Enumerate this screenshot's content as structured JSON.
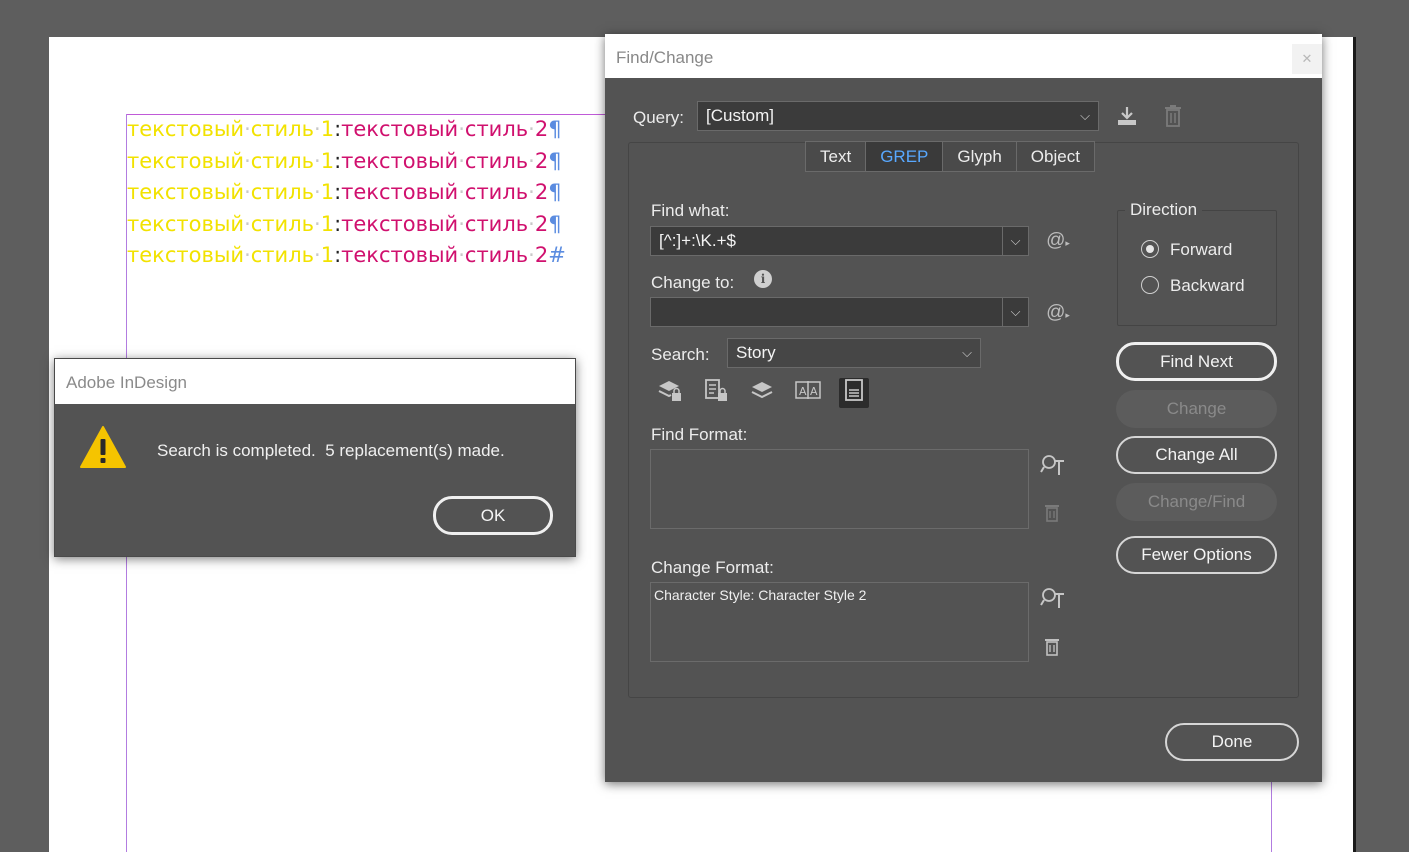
{
  "document": {
    "lines": [
      {
        "a": "текстовый",
        "b": "стиль",
        "c": "1",
        "sep": ":",
        "d": "текстовый",
        "e": "стиль",
        "f": "2",
        "end": "¶"
      },
      {
        "a": "текстовый",
        "b": "стиль",
        "c": "1",
        "sep": ":",
        "d": "текстовый",
        "e": "стиль",
        "f": "2",
        "end": "¶"
      },
      {
        "a": "текстовый",
        "b": "стиль",
        "c": "1",
        "sep": ":",
        "d": "текстовый",
        "e": "стиль",
        "f": "2",
        "end": "¶"
      },
      {
        "a": "текстовый",
        "b": "стиль",
        "c": "1",
        "sep": ":",
        "d": "текстовый",
        "e": "стиль",
        "f": "2",
        "end": "¶"
      },
      {
        "a": "текстовый",
        "b": "стиль",
        "c": "1",
        "sep": ":",
        "d": "текстовый",
        "e": "стиль",
        "f": "2",
        "end": "#"
      }
    ],
    "colors": {
      "style1": "#f2e200",
      "style2": "#d0106e",
      "hidden_chars": "#5b8ce0"
    }
  },
  "find_change": {
    "title": "Find/Change",
    "close": "✕",
    "query_label": "Query:",
    "query_value": "[Custom]",
    "tabs": [
      {
        "label": "Text"
      },
      {
        "label": "GREP",
        "active": true
      },
      {
        "label": "Glyph"
      },
      {
        "label": "Object"
      }
    ],
    "find_what_label": "Find what:",
    "find_what_value": "[^:]+:\\K.+$",
    "change_to_label": "Change to:",
    "change_to_value": "",
    "search_label": "Search:",
    "search_value": "Story",
    "find_format_label": "Find Format:",
    "find_format_value": "",
    "change_format_label": "Change Format:",
    "change_format_value": "Character Style: Character Style 2",
    "direction": {
      "title": "Direction",
      "options": [
        {
          "label": "Forward",
          "selected": true
        },
        {
          "label": "Backward",
          "selected": false
        }
      ]
    },
    "buttons": {
      "find_next": "Find Next",
      "change": "Change",
      "change_all": "Change All",
      "change_find": "Change/Find",
      "fewer_options": "Fewer Options",
      "done": "Done"
    },
    "icons": {
      "save_query": "save-query-icon",
      "delete_query": "trash-icon",
      "special_chars": "@",
      "info": "i",
      "options": [
        "locked-layers-icon",
        "locked-stories-icon",
        "hidden-layers-icon",
        "case-sensitive-icon",
        "footnotes-icon"
      ]
    }
  },
  "alert": {
    "title": "Adobe InDesign",
    "message": "Search is completed.  5 replacement(s) made.",
    "ok": "OK"
  }
}
